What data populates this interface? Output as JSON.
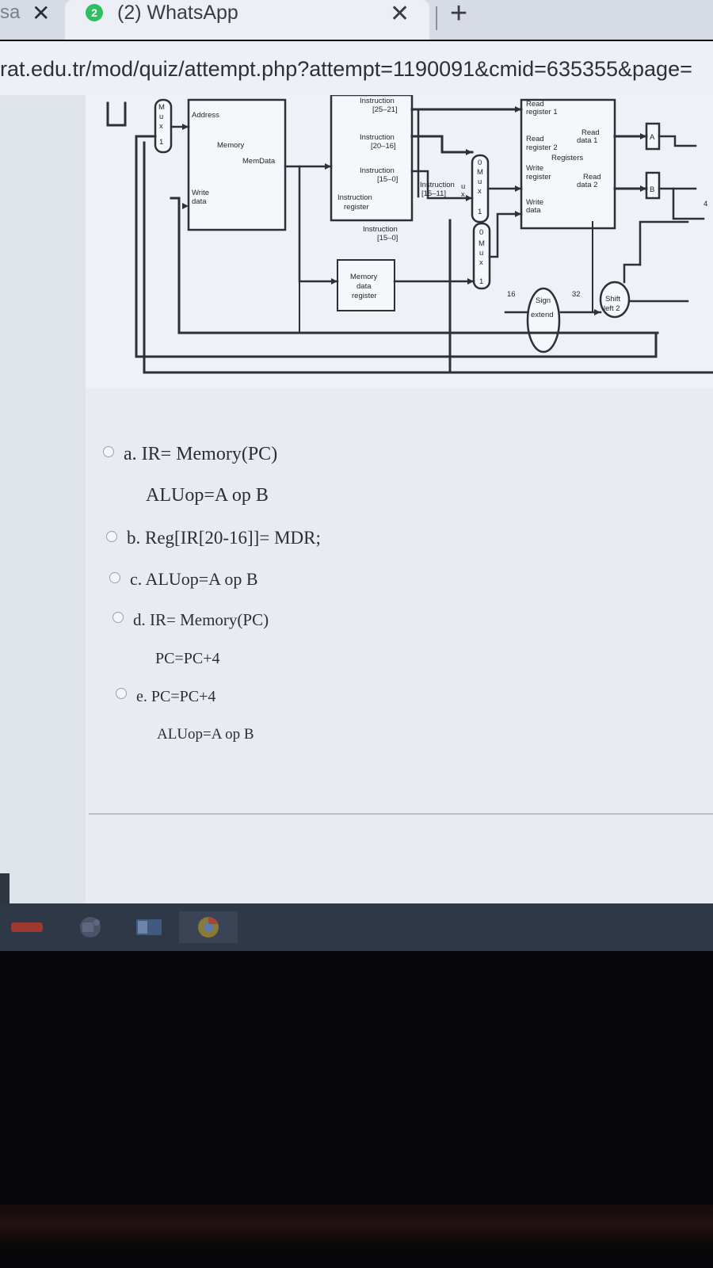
{
  "browser": {
    "left_tab": {
      "title": "sa",
      "close": "✕"
    },
    "active_tab": {
      "badge": "2",
      "title": "(2) WhatsApp",
      "close": "✕"
    },
    "new_tab": "+",
    "url": "rat.edu.tr/mod/quiz/attempt.php?attempt=1190091&cmid=635355&page="
  },
  "diagram": {
    "mux_left": [
      "M",
      "u",
      "x",
      "1"
    ],
    "memory": {
      "address": "Address",
      "title": "Memory",
      "memdata": "MemData",
      "write_data_1": "Write",
      "write_data_2": "data"
    },
    "ir": {
      "f1_1": "Instruction",
      "f1_2": "[25–21]",
      "f2_1": "Instruction",
      "f2_2": "[20–16]",
      "f3_1": "Instruction",
      "f3_2": "[15–0]",
      "reg_1": "Instruction",
      "reg_2": "register",
      "f4_1": "Instruction",
      "f4_2": "[15–0]",
      "f5_1": "Instruction",
      "f5_2": "[15–11]"
    },
    "mdr": [
      "Memory",
      "data",
      "register"
    ],
    "registers": {
      "rr1_1": "Read",
      "rr1_2": "register 1",
      "rr2_1": "Read",
      "rr2_2": "register 2",
      "rd1_1": "Read",
      "rd1_2": "data 1",
      "title": "Registers",
      "wr_1": "Write",
      "wr_2": "register",
      "rd2_1": "Read",
      "rd2_2": "data 2",
      "wd_1": "Write",
      "wd_2": "data"
    },
    "mux_mid1": [
      "0",
      "M",
      "u",
      "x",
      "1"
    ],
    "mux_mid2": [
      "0",
      "M",
      "u",
      "x",
      "1"
    ],
    "mux_reg": [
      "u",
      "x"
    ],
    "sign_extend": {
      "in": "16",
      "out": "32",
      "l1": "Sign",
      "l2": "extend"
    },
    "shift_left": {
      "l1": "Shift",
      "l2": "left 2"
    },
    "reg_a": "A",
    "reg_b": "B",
    "four": "4"
  },
  "options": [
    {
      "id": "a",
      "lines": [
        "a. IR= Memory(PC)",
        "ALUop=A op B"
      ]
    },
    {
      "id": "b",
      "lines": [
        "b. Reg[IR[20-16]]= MDR;"
      ]
    },
    {
      "id": "c",
      "lines": [
        "c. ALUop=A op B"
      ]
    },
    {
      "id": "d",
      "lines": [
        "d. IR= Memory(PC)",
        "PC=PC+4"
      ]
    },
    {
      "id": "e",
      "lines": [
        "e. PC=PC+4",
        "ALUop=A op B"
      ]
    }
  ],
  "taskbar": {
    "icons": [
      "app-icon",
      "teams-icon",
      "outlook-icon",
      "chrome-icon"
    ],
    "colors": {
      "taskbar": "#2e3846",
      "accent": "#c0392b"
    }
  }
}
